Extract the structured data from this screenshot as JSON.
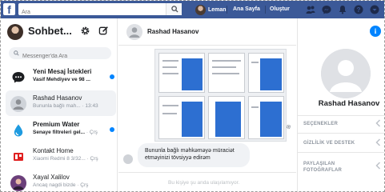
{
  "topbar": {
    "logo": "f",
    "search_placeholder": "Ara",
    "user_name": "Leman",
    "home_label": "Ana Sayfa",
    "create_label": "Oluştur",
    "brand_color": "#3b5998"
  },
  "sidebar": {
    "title": "Sohbet...",
    "search_placeholder": "Messenger'da Ara",
    "conversations": [
      {
        "name": "Yeni Mesaj İstekleri",
        "sub": "Vasif  Mehdiyev ve 98 ...",
        "time": "",
        "unread": true
      },
      {
        "name": "Rashad Hasanov",
        "sub": "Bununla bağlı mah...",
        "time": "· 13:43",
        "unread": false
      },
      {
        "name": "Premium Water",
        "sub": "Senaye filtreleri gel...",
        "time": "· Çrş",
        "unread": true
      },
      {
        "name": "Kontakt Home",
        "sub": "Xiaomi Redmi 8 3/32...",
        "time": "· Çrş",
        "unread": false
      },
      {
        "name": "Xayal Xalilov",
        "sub": "Ancaq nagdi bizde",
        "time": "· Çrş",
        "unread": false
      }
    ]
  },
  "chat": {
    "peer_name": "Rashad Hasanov",
    "incoming_message": "Bununla bağlı məhkəməyə müraciət etməyinizi tövsiyyə edirəm",
    "composer_placeholder": "Bu kişiye şu anda ulaşılamıyor."
  },
  "details": {
    "name": "Rashad Hasanov",
    "sections": [
      "SEÇENEKLER",
      "GİZLİLİK VE DESTEK",
      "PAYLAŞILAN FOTOĞRAFLAR"
    ]
  },
  "icons": [
    "search-icon",
    "friend-requests-icon",
    "messages-icon",
    "notifications-icon",
    "help-icon",
    "account-menu-icon",
    "gear-icon",
    "compose-icon",
    "info-icon",
    "chevron-left-icon"
  ],
  "accent_color": "#0084ff"
}
